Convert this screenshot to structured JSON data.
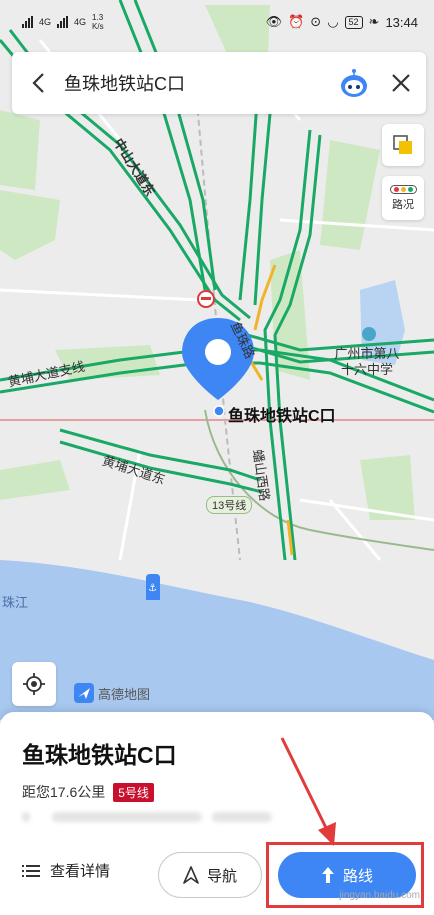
{
  "status_bar": {
    "signal1": "4G",
    "signal2": "4G",
    "net_speed": "1.3",
    "net_unit": "K/s",
    "battery": "52",
    "time": "13:44"
  },
  "search": {
    "query": "鱼珠地铁站C口"
  },
  "map": {
    "traffic_label": "路况",
    "roads": {
      "zhongshan": "中山大道东",
      "huangpu_zhi": "黄埔大道支线",
      "huangpu": "黄埔大道东",
      "panshan": "蟠山西路",
      "yuzhu": "鱼珠路"
    },
    "school": "广州市第八十六中学",
    "metro_badge": "13号线",
    "river": "珠江",
    "pin_label": "鱼珠地铁站C口",
    "logo_text": "高德地图"
  },
  "sheet": {
    "place_name": "鱼珠地铁站C口",
    "distance": "距您17.6公里",
    "line_badge": "5号线",
    "details_label": "查看详情",
    "nav_label": "导航",
    "route_label": "路线",
    "watermark": "jingyan.baidu.com"
  },
  "colors": {
    "accent": "#3d86f4",
    "road_green": "#1aa866",
    "line5": "#c8102e",
    "highlight": "#e23b3b"
  }
}
